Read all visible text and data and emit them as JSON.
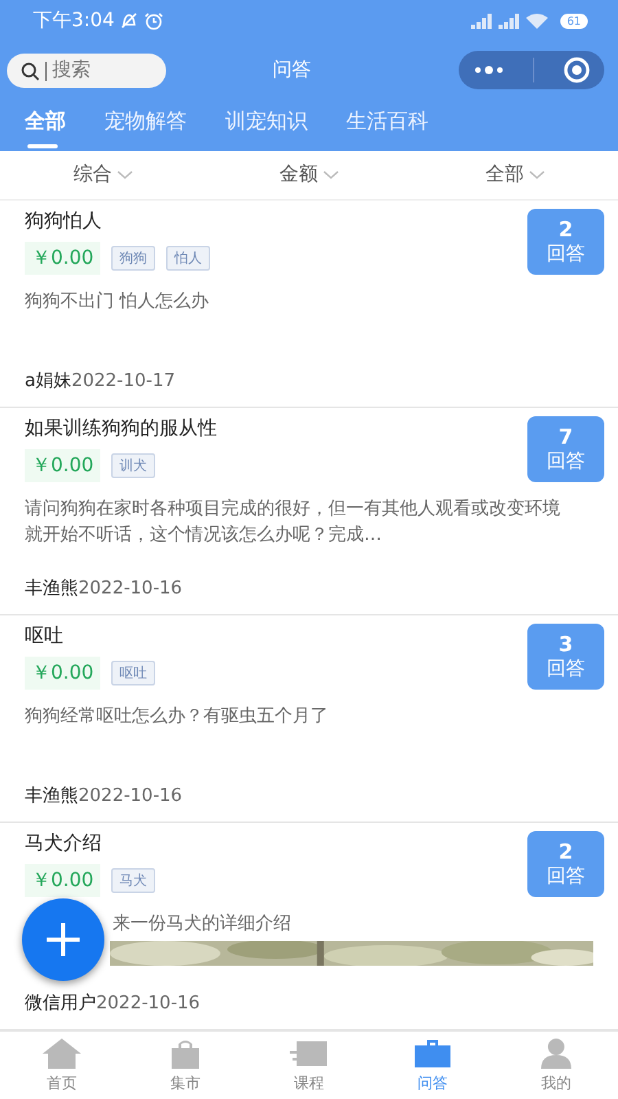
{
  "status_bar": {
    "time": "下午3:04",
    "battery": "61"
  },
  "header": {
    "search_placeholder": "搜索",
    "title": "问答"
  },
  "tabs": [
    {
      "label": "全部",
      "selected": true
    },
    {
      "label": "宠物解答",
      "selected": false
    },
    {
      "label": "训宠知识",
      "selected": false
    },
    {
      "label": "生活百科",
      "selected": false
    }
  ],
  "filters": [
    "综合",
    "金额",
    "全部"
  ],
  "questions": [
    {
      "title": "狗狗怕人",
      "price": "￥0.00",
      "tags": [
        "狗狗",
        "怕人"
      ],
      "answers": "2",
      "answers_label": "回答",
      "description": "狗狗不出门 怕人怎么办",
      "author": "a娟妹",
      "date": "2022-10-17"
    },
    {
      "title": "如果训练狗狗的服从性",
      "price": "￥0.00",
      "tags": [
        "训犬"
      ],
      "answers": "7",
      "answers_label": "回答",
      "description": "请问狗狗在家时各种项目完成的很好，但一有其他人观看或改变环境就开始不听话，这个情况该怎么办呢？完成…",
      "author": "丰渔熊",
      "date": "2022-10-16"
    },
    {
      "title": "呕吐",
      "price": "￥0.00",
      "tags": [
        "呕吐"
      ],
      "answers": "3",
      "answers_label": "回答",
      "description": "狗狗经常呕吐怎么办？有驱虫五个月了",
      "author": "丰渔熊",
      "date": "2022-10-16"
    },
    {
      "title": "马犬介绍",
      "price": "￥0.00",
      "tags": [
        "马犬"
      ],
      "answers": "2",
      "answers_label": "回答",
      "description": "来一份马犬的详细介绍",
      "author": "微信用户",
      "date": "2022-10-16",
      "picture": {
        "kind": "picture"
      }
    }
  ],
  "tab_bar": [
    {
      "label": "首页",
      "selected": false,
      "kind": "home"
    },
    {
      "label": "集市",
      "selected": false,
      "kind": "bag"
    },
    {
      "label": "课程",
      "selected": false,
      "kind": "mail"
    },
    {
      "label": "问答",
      "selected": true,
      "kind": "case"
    },
    {
      "label": "我的",
      "selected": false,
      "kind": "user"
    }
  ]
}
